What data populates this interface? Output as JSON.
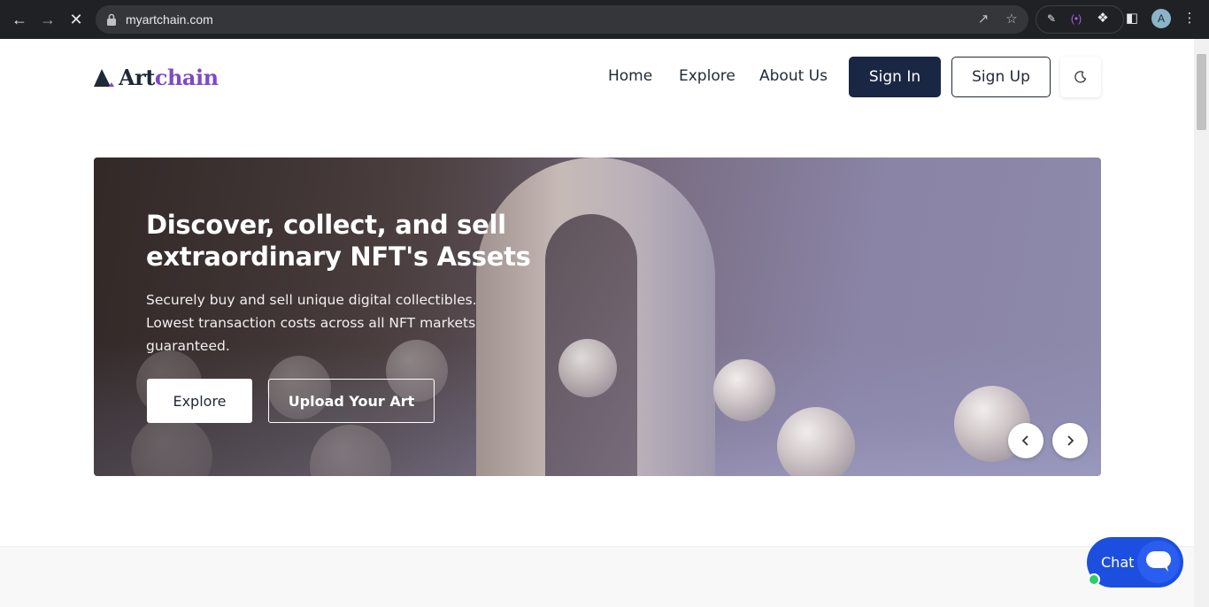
{
  "browser": {
    "url": "myartchain.com",
    "avatar_letter": "A"
  },
  "header": {
    "logo_part1": "Art",
    "logo_part2": "chain",
    "nav": [
      "Home",
      "Explore",
      "About Us"
    ],
    "signin_label": "Sign In",
    "signup_label": "Sign Up",
    "theme_icon": "moon-icon"
  },
  "hero": {
    "title": "Discover, collect, and sell extraordinary NFT's Assets",
    "description": "Securely buy and sell unique digital collectibles. Lowest transaction costs across all NFT markets guaranteed.",
    "explore_label": "Explore",
    "upload_label": "Upload Your Art",
    "prev_icon": "chevron-left-icon",
    "next_icon": "chevron-right-icon"
  },
  "chat": {
    "label": "Chat",
    "icon": "chat-bubble-icon",
    "status_color": "#2ecc71"
  },
  "colors": {
    "brand_dark": "#1a2744",
    "brand_purple": "#7c4bc4",
    "chat_blue": "#1c4fe0"
  }
}
